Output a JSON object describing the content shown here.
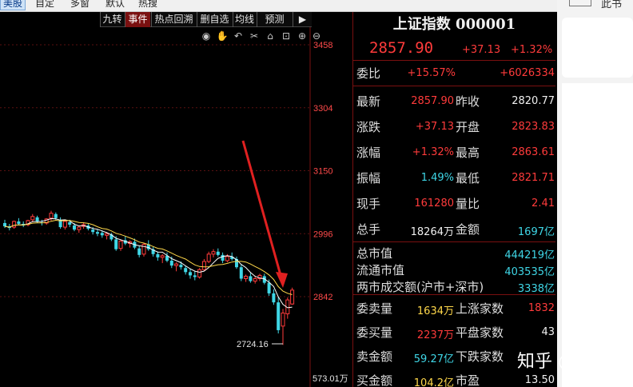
{
  "menubar": {
    "items": [
      "美股",
      "自定",
      "多窗",
      "默认",
      "热搜"
    ]
  },
  "toolbar": {
    "tabs": [
      "九转",
      "事件",
      "热点回溯",
      "删自选",
      "均线",
      "预测"
    ],
    "active_tab": "事件",
    "arrow_label": "▶"
  },
  "chart_data": {
    "type": "candlestick",
    "y_ticks": [
      "3458",
      "3304",
      "3150",
      "2996",
      "2842"
    ],
    "ylim": [
      2700,
      3520
    ],
    "low_label": "2724.16",
    "volume_label": "573.01万",
    "up_color": "#ff3b3b",
    "down_color": "#3fd6e6",
    "ma_colors": [
      "#ffffff",
      "#ffd84a"
    ]
  },
  "panel": {
    "title": "上证指数 000001",
    "price": "2857.90",
    "change": "+37.13",
    "change_pct": "+1.32%",
    "ratio_label": "委比",
    "ratio_pct": "+15.57%",
    "ratio_diff": "+6026334",
    "rows": [
      {
        "l1": "最新",
        "v1": "2857.90",
        "l2": "昨收",
        "v2": "2820.77"
      },
      {
        "l1": "涨跌",
        "v1": "+37.13",
        "l2": "开盘",
        "v2": "2823.83"
      },
      {
        "l1": "涨幅",
        "v1": "+1.32%",
        "l2": "最高",
        "v2": "2863.61"
      },
      {
        "l1": "振幅",
        "v1": "1.49%",
        "l2": "最低",
        "v2": "2821.71"
      },
      {
        "l1": "现手",
        "v1": "161280",
        "l2": "量比",
        "v2": "2.41"
      },
      {
        "l1": "总手",
        "v1": "18264万",
        "l2": "金额",
        "v2": "1697亿"
      }
    ],
    "market": [
      {
        "label": "总市值",
        "value": "444219亿"
      },
      {
        "label": "流通市值",
        "value": "403535亿"
      },
      {
        "label": "两市成交额(沪市+深市)",
        "value": "3338亿"
      }
    ],
    "bottom_rows": [
      {
        "l1": "委卖量",
        "v1": "1634万",
        "l2": "上涨家数",
        "v2": "1832"
      },
      {
        "l1": "委买量",
        "v1": "2237万",
        "l2": "平盘家数",
        "v2": "43"
      },
      {
        "l1": "卖金额",
        "v1": "59.27亿",
        "l2": "下跌家数",
        "v2": ""
      },
      {
        "l1": "买金额",
        "v1": "104.2亿",
        "l2": "市盈",
        "v2": "13.50"
      }
    ]
  },
  "watermark": "知乎 @凌乐",
  "side": {
    "text": "此书"
  }
}
